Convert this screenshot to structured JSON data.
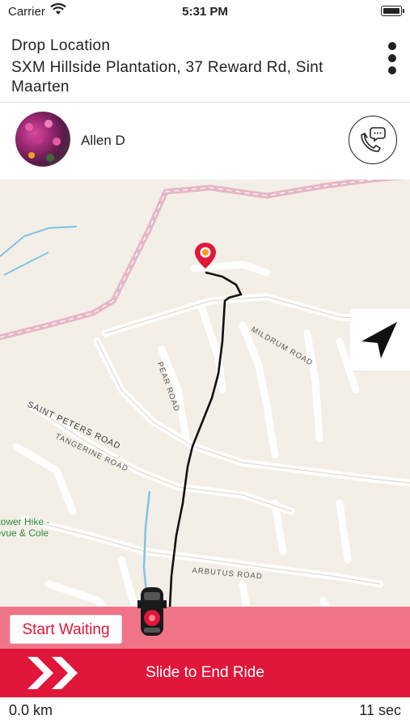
{
  "status_bar": {
    "carrier": "Carrier",
    "time": "5:31 PM"
  },
  "header": {
    "title": "Drop Location",
    "address": "SXM Hillside Plantation, 37 Reward Rd, Sint Maarten",
    "menu_icon": "more-vertical-icon"
  },
  "driver": {
    "name": "Allen D",
    "call_icon": "phone-chat-icon"
  },
  "map": {
    "roads": [
      "MILDRUM ROAD",
      "PEAR ROAD",
      "SAINT PETERS ROAD",
      "TANGERINE ROAD",
      "ARBUTUS ROAD"
    ],
    "poi": "lltower Hike -\nlevue & Cole\nv",
    "destination_marker": "location-pin-icon",
    "vehicle_icon": "car-top-view-icon",
    "recenter_icon": "navigation-arrow-icon"
  },
  "actions": {
    "start_waiting": "Start Waiting",
    "slide_label": "Slide to End Ride"
  },
  "footer": {
    "distance": "0.0 km",
    "duration": "11 sec"
  },
  "colors": {
    "accent": "#e0163a",
    "accent_light": "#f07487",
    "map_bg": "#f3efe7",
    "route": "#111111"
  }
}
